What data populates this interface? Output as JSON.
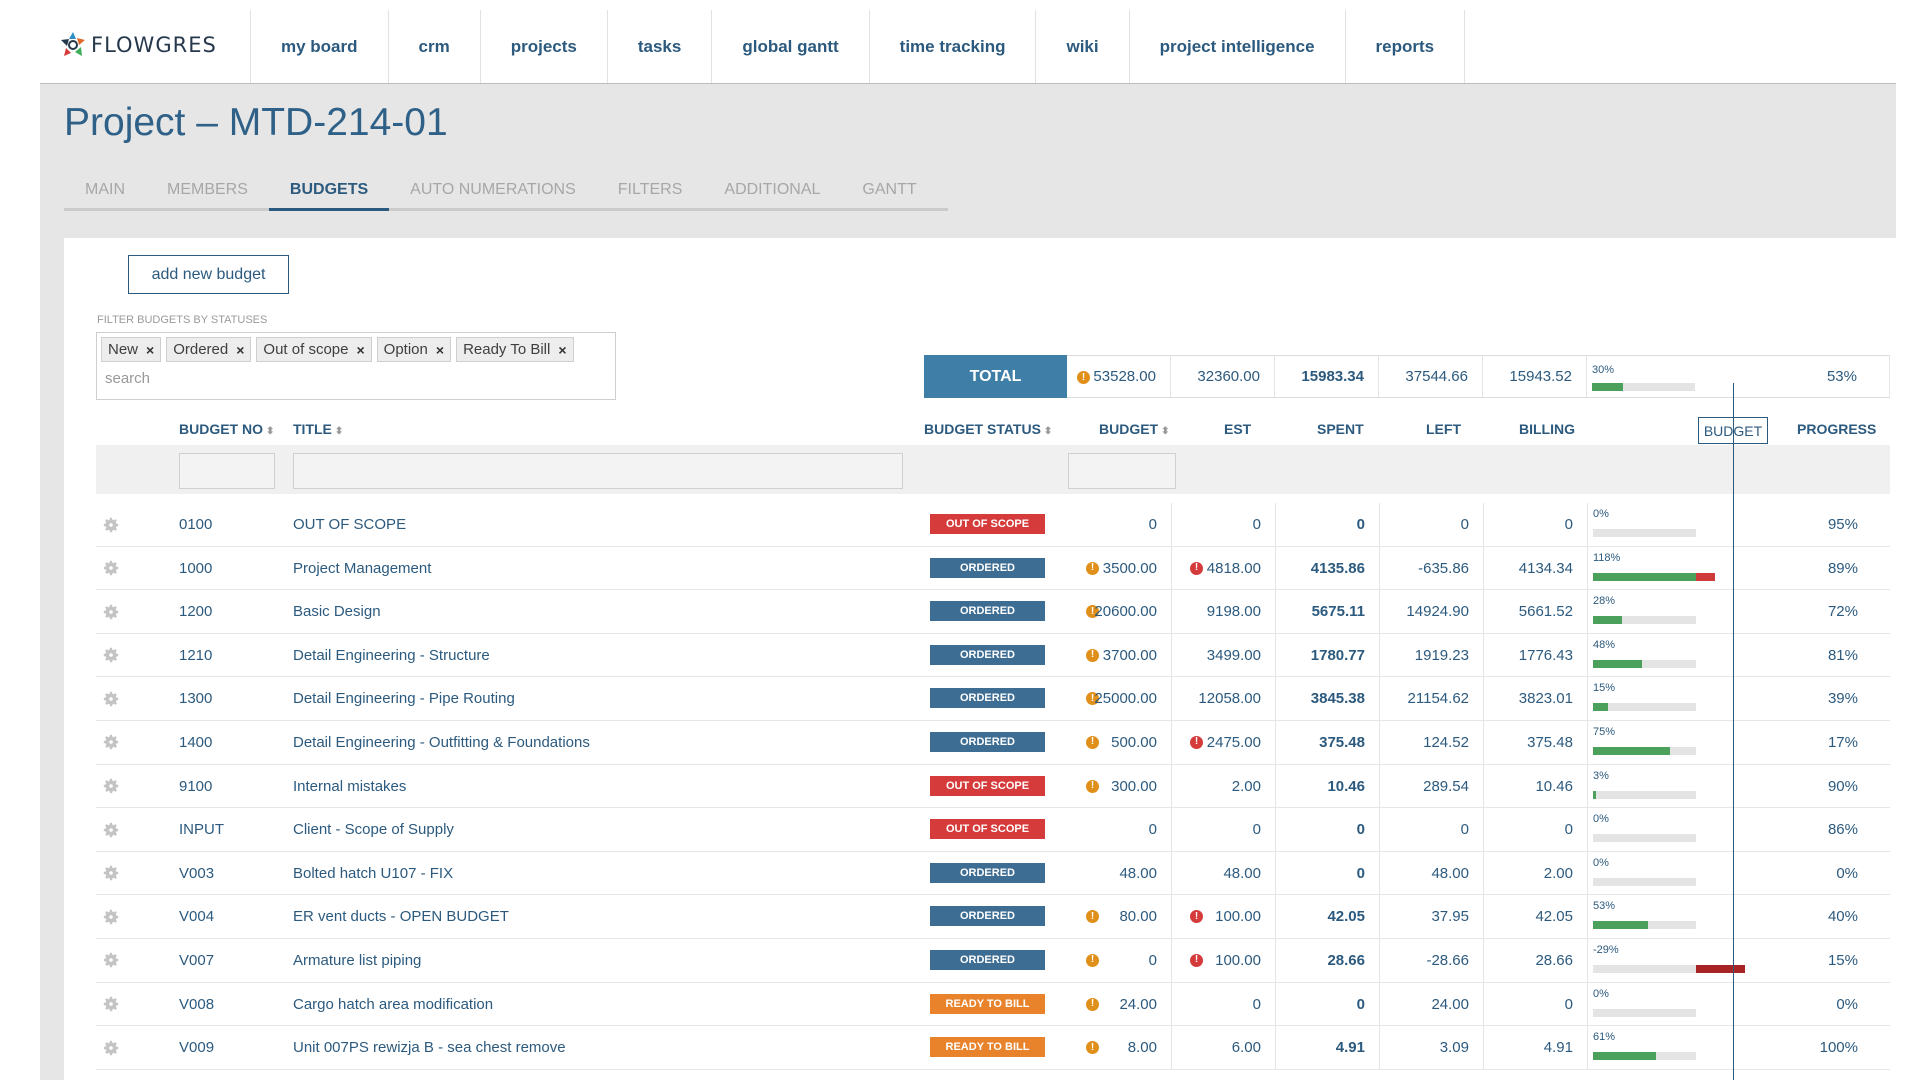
{
  "app": {
    "name": "FLOWGRES"
  },
  "nav": [
    "my board",
    "crm",
    "projects",
    "tasks",
    "global gantt",
    "time tracking",
    "wiki",
    "project intelligence",
    "reports"
  ],
  "page": {
    "title": "Project – MTD-214-01"
  },
  "tabs": [
    "MAIN",
    "MEMBERS",
    "BUDGETS",
    "AUTO NUMERATIONS",
    "FILTERS",
    "ADDITIONAL",
    "GANTT"
  ],
  "active_tab": "BUDGETS",
  "actions": {
    "add_budget": "add new budget"
  },
  "filter": {
    "label": "FILTER BUDGETS BY STATUSES",
    "chips": [
      "New",
      "Ordered",
      "Out of scope",
      "Option",
      "Ready To Bill"
    ],
    "remove_glyph": "×",
    "search_placeholder": "search"
  },
  "totals": {
    "label": "TOTAL",
    "budget": "53528.00",
    "est": "32360.00",
    "spent": "15983.34",
    "left": "37544.66",
    "billing": "15943.52",
    "bar_percent": "30%",
    "bar_value": 30,
    "progress": "53%"
  },
  "columns": {
    "budget_no": "BUDGET NO",
    "title": "TITLE",
    "budget_status": "BUDGET STATUS",
    "budget": "BUDGET",
    "est": "EST",
    "spent": "SPENT",
    "left": "LEFT",
    "billing": "BILLING",
    "budget_marker": "BUDGET",
    "progress": "PROGRESS",
    "sort_glyph": "⬍"
  },
  "colors": {
    "accent": "#2c5a7e",
    "total_bg": "#3f7ea7",
    "out_of_scope": "#d63b3b",
    "ordered": "#3e6d93",
    "ready_to_bill": "#e8822b",
    "warn_orange": "#e0901a",
    "warn_red": "#d63b3b",
    "bar_green": "#4ba15c"
  },
  "rows": [
    {
      "no": "0100",
      "title": "OUT OF SCOPE",
      "status": "OUT OF SCOPE",
      "status_key": "out_of_scope",
      "budget_warn": false,
      "budget": "0",
      "est_warn": false,
      "est": "0",
      "spent": "0",
      "left": "0",
      "billing": "0",
      "bar_label": "0%",
      "bar_value": 0,
      "progress": "95%"
    },
    {
      "no": "1000",
      "title": "Project Management",
      "status": "ORDERED",
      "status_key": "ordered",
      "budget_warn": true,
      "budget": "3500.00",
      "est_warn": true,
      "est": "4818.00",
      "spent": "4135.86",
      "left": "-635.86",
      "billing": "4134.34",
      "bar_label": "118%",
      "bar_value": 118,
      "progress": "89%"
    },
    {
      "no": "1200",
      "title": "Basic Design",
      "status": "ORDERED",
      "status_key": "ordered",
      "budget_warn": true,
      "budget": "20600.00",
      "est_warn": false,
      "est": "9198.00",
      "spent": "5675.11",
      "left": "14924.90",
      "billing": "5661.52",
      "bar_label": "28%",
      "bar_value": 28,
      "progress": "72%"
    },
    {
      "no": "1210",
      "title": "Detail Engineering - Structure",
      "status": "ORDERED",
      "status_key": "ordered",
      "budget_warn": true,
      "budget": "3700.00",
      "est_warn": false,
      "est": "3499.00",
      "spent": "1780.77",
      "left": "1919.23",
      "billing": "1776.43",
      "bar_label": "48%",
      "bar_value": 48,
      "progress": "81%"
    },
    {
      "no": "1300",
      "title": "Detail Engineering - Pipe Routing",
      "status": "ORDERED",
      "status_key": "ordered",
      "budget_warn": true,
      "budget": "25000.00",
      "est_warn": false,
      "est": "12058.00",
      "spent": "3845.38",
      "left": "21154.62",
      "billing": "3823.01",
      "bar_label": "15%",
      "bar_value": 15,
      "progress": "39%"
    },
    {
      "no": "1400",
      "title": "Detail Engineering - Outfitting & Foundations",
      "status": "ORDERED",
      "status_key": "ordered",
      "budget_warn": true,
      "budget": "500.00",
      "est_warn": true,
      "est": "2475.00",
      "spent": "375.48",
      "left": "124.52",
      "billing": "375.48",
      "bar_label": "75%",
      "bar_value": 75,
      "progress": "17%"
    },
    {
      "no": "9100",
      "title": "Internal mistakes",
      "status": "OUT OF SCOPE",
      "status_key": "out_of_scope",
      "budget_warn": true,
      "budget": "300.00",
      "est_warn": false,
      "est": "2.00",
      "spent": "10.46",
      "left": "289.54",
      "billing": "10.46",
      "bar_label": "3%",
      "bar_value": 3,
      "progress": "90%"
    },
    {
      "no": "INPUT",
      "title": "Client - Scope of Supply",
      "status": "OUT OF SCOPE",
      "status_key": "out_of_scope",
      "budget_warn": false,
      "budget": "0",
      "est_warn": false,
      "est": "0",
      "spent": "0",
      "left": "0",
      "billing": "0",
      "bar_label": "0%",
      "bar_value": 0,
      "progress": "86%"
    },
    {
      "no": "V003",
      "title": "Bolted hatch U107 - FIX",
      "status": "ORDERED",
      "status_key": "ordered",
      "budget_warn": false,
      "budget": "48.00",
      "est_warn": false,
      "est": "48.00",
      "spent": "0",
      "left": "48.00",
      "billing": "2.00",
      "bar_label": "0%",
      "bar_value": 0,
      "progress": "0%"
    },
    {
      "no": "V004",
      "title": "ER vent ducts - OPEN BUDGET",
      "status": "ORDERED",
      "status_key": "ordered",
      "budget_warn": true,
      "budget": "80.00",
      "est_warn": true,
      "est": "100.00",
      "spent": "42.05",
      "left": "37.95",
      "billing": "42.05",
      "bar_label": "53%",
      "bar_value": 53,
      "progress": "40%"
    },
    {
      "no": "V007",
      "title": "Armature list piping",
      "status": "ORDERED",
      "status_key": "ordered",
      "budget_warn": true,
      "budget": "0",
      "est_warn": true,
      "est": "100.00",
      "spent": "28.66",
      "left": "-28.66",
      "billing": "28.66",
      "bar_label": "-29%",
      "bar_value": -29,
      "progress": "15%"
    },
    {
      "no": "V008",
      "title": "Cargo hatch area modification",
      "status": "READY TO BILL",
      "status_key": "ready_to_bill",
      "budget_warn": true,
      "budget": "24.00",
      "est_warn": false,
      "est": "0",
      "spent": "0",
      "left": "24.00",
      "billing": "0",
      "bar_label": "0%",
      "bar_value": 0,
      "progress": "0%"
    },
    {
      "no": "V009",
      "title": "Unit 007PS rewizja B - sea chest remove",
      "status": "READY TO BILL",
      "status_key": "ready_to_bill",
      "budget_warn": true,
      "budget": "8.00",
      "est_warn": false,
      "est": "6.00",
      "spent": "4.91",
      "left": "3.09",
      "billing": "4.91",
      "bar_label": "61%",
      "bar_value": 61,
      "progress": "100%"
    }
  ]
}
